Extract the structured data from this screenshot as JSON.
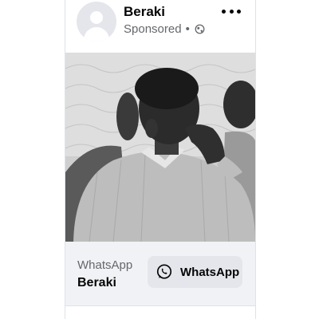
{
  "post": {
    "page_name": "Beraki",
    "sponsored_label": "Sponsored",
    "separator": "•",
    "privacy_icon": "globe-icon",
    "menu_icon": "more-dots-icon"
  },
  "cta": {
    "source": "WhatsApp",
    "title": "Beraki",
    "button_label": "WhatsApp",
    "button_icon": "whatsapp-icon"
  },
  "colors": {
    "card_bg": "#ffffff",
    "cta_bg": "#f0f2f5",
    "button_bg": "#e4e6eb",
    "secondary_text": "#65676b",
    "primary_text": "#050505"
  }
}
